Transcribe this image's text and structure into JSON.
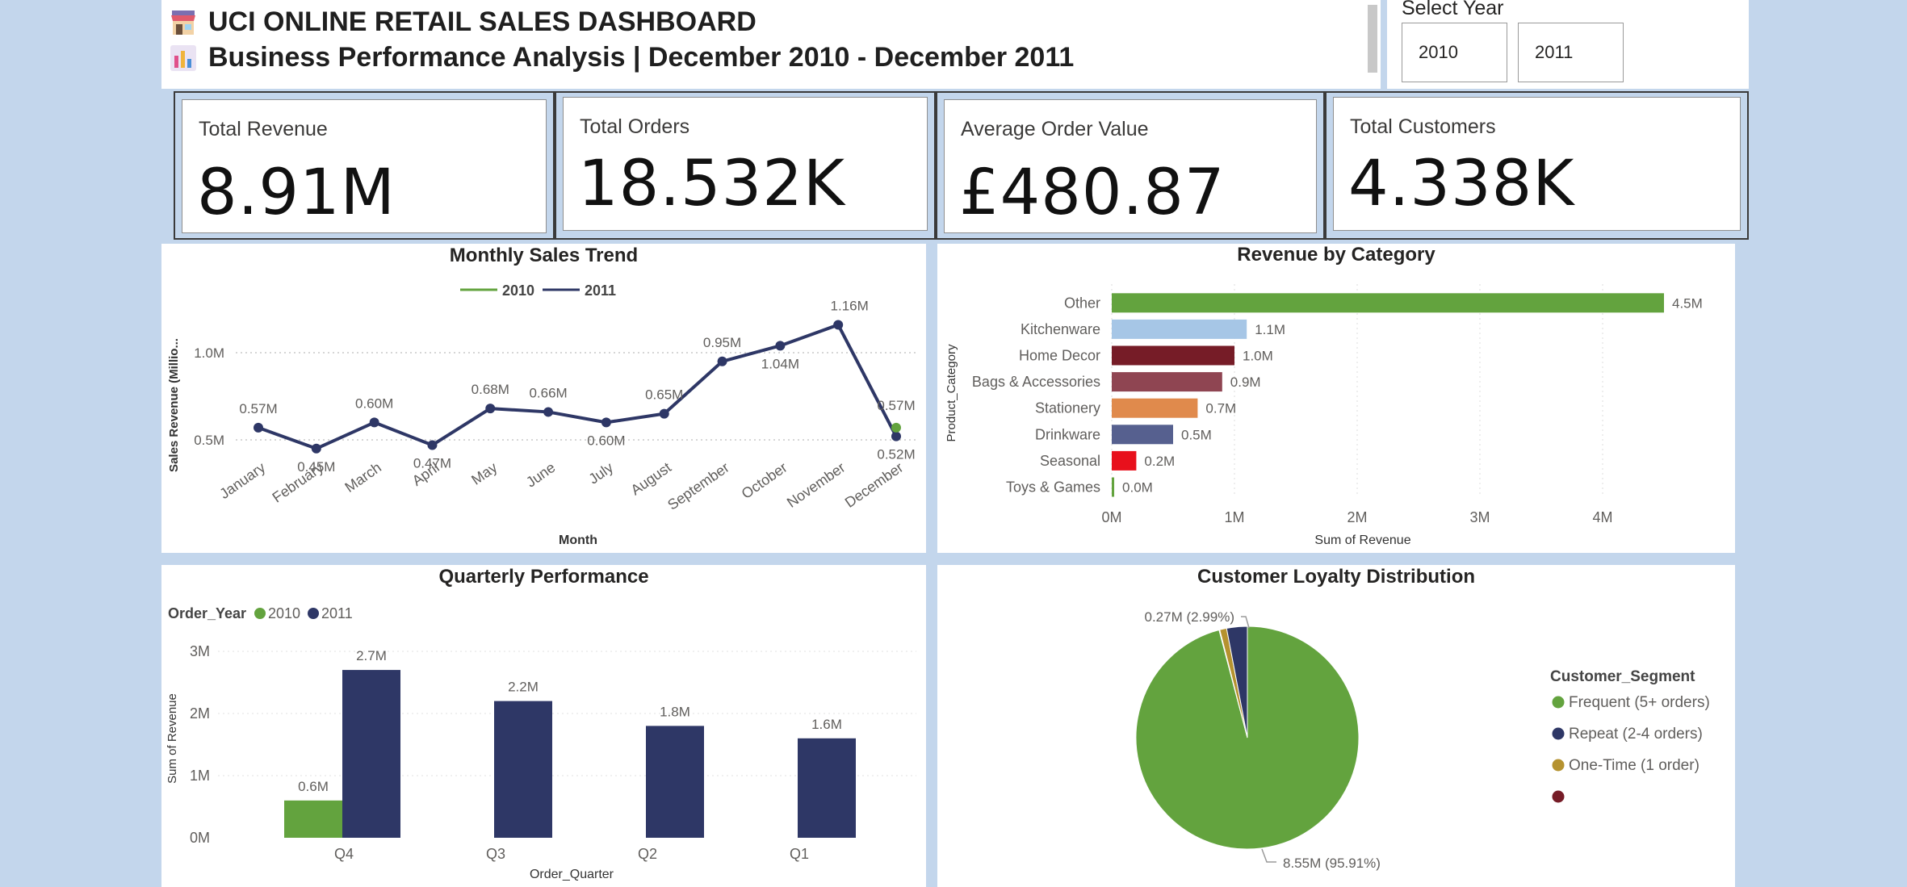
{
  "header": {
    "title": "UCI ONLINE RETAIL SALES DASHBOARD",
    "subtitle": "Business Performance Analysis | December 2010 - December 2011",
    "title_icon": "store-icon",
    "subtitle_icon": "bar-chart-icon"
  },
  "slicer": {
    "title": "Select Year",
    "options": [
      "2010",
      "2011"
    ]
  },
  "kpis": [
    {
      "label": "Total Revenue",
      "value": "8.91M"
    },
    {
      "label": "Total Orders",
      "value": "18.532K"
    },
    {
      "label": "Average Order Value",
      "value": "£480.87"
    },
    {
      "label": "Total Customers",
      "value": "4.338K"
    }
  ],
  "colors": {
    "green": "#63a33e",
    "navy": "#2e3766",
    "background": "#c3d6ec"
  },
  "chart_data": [
    {
      "type": "line",
      "title": "Monthly Sales Trend",
      "xlabel": "Month",
      "ylabel": "Sales Revenue (Millio...",
      "yticks": [
        "0.5M",
        "1.0M"
      ],
      "categories": [
        "January",
        "February",
        "March",
        "April",
        "May",
        "June",
        "July",
        "August",
        "September",
        "October",
        "November",
        "December"
      ],
      "series": [
        {
          "name": "2010",
          "color": "#63a33e",
          "x": [
            "December"
          ],
          "values": [
            0.57
          ],
          "labels": [
            "0.57M"
          ]
        },
        {
          "name": "2011",
          "color": "#2e3766",
          "values": [
            0.57,
            0.45,
            0.6,
            0.47,
            0.68,
            0.66,
            0.6,
            0.65,
            0.95,
            1.04,
            1.16,
            0.52
          ],
          "labels": [
            "0.57M",
            "0.45M",
            "0.60M",
            "0.47M",
            "0.68M",
            "0.66M",
            "0.60M",
            "0.65M",
            "0.95M",
            "1.04M",
            "1.16M",
            "0.52M"
          ]
        }
      ],
      "ylim": [
        0.3,
        1.2
      ],
      "legend": "top-center",
      "grid": "dotted"
    },
    {
      "type": "bar",
      "orientation": "horizontal",
      "title": "Revenue by Category",
      "xlabel": "Sum of Revenue",
      "ylabel": "Product_Category",
      "categories": [
        "Other",
        "Kitchenware",
        "Home Decor",
        "Bags & Accessories",
        "Stationery",
        "Drinkware",
        "Seasonal",
        "Toys & Games"
      ],
      "values": [
        4.5,
        1.1,
        1.0,
        0.9,
        0.7,
        0.5,
        0.2,
        0.02
      ],
      "labels": [
        "4.5M",
        "1.1M",
        "1.0M",
        "0.9M",
        "0.7M",
        "0.5M",
        "0.2M",
        "0.0M"
      ],
      "bar_colors": [
        "#63a33e",
        "#a6c6e6",
        "#761c27",
        "#8f4552",
        "#e08a4c",
        "#56608f",
        "#e8101c",
        "#63a33e"
      ],
      "xticks": [
        "0M",
        "1M",
        "2M",
        "3M",
        "4M"
      ],
      "xlim": [
        0,
        4.5
      ]
    },
    {
      "type": "bar",
      "title": "Quarterly Performance",
      "xlabel": "Order_Quarter",
      "ylabel": "Sum of Revenue",
      "legend_title": "Order_Year",
      "categories": [
        "Q4",
        "Q3",
        "Q2",
        "Q1"
      ],
      "series": [
        {
          "name": "2010",
          "color": "#63a33e",
          "values": [
            0.6,
            null,
            null,
            null
          ],
          "labels": [
            "0.6M",
            "",
            "",
            ""
          ]
        },
        {
          "name": "2011",
          "color": "#2e3766",
          "values": [
            2.7,
            2.2,
            1.8,
            1.6
          ],
          "labels": [
            "2.7M",
            "2.2M",
            "1.8M",
            "1.6M"
          ]
        }
      ],
      "yticks": [
        "0M",
        "1M",
        "2M",
        "3M"
      ],
      "ylim": [
        0,
        3
      ]
    },
    {
      "type": "pie",
      "title": "Customer Loyalty Distribution",
      "legend_title": "Customer_Segment",
      "slices": [
        {
          "name": "Frequent (5+ orders)",
          "value": 8.55,
          "pct": 95.91,
          "color": "#63a33e",
          "label": "8.55M (95.91%)"
        },
        {
          "name": "Repeat (2-4 orders)",
          "value": 0.27,
          "pct": 2.99,
          "color": "#2e3766",
          "label": "0.27M (2.99%)"
        },
        {
          "name": "One-Time (1 order)",
          "value": 0.09,
          "pct": 1.0,
          "color": "#b5922f",
          "label": ""
        },
        {
          "name": "",
          "value": 0.01,
          "pct": 0.1,
          "color": "#761c27",
          "label": ""
        }
      ]
    }
  ]
}
